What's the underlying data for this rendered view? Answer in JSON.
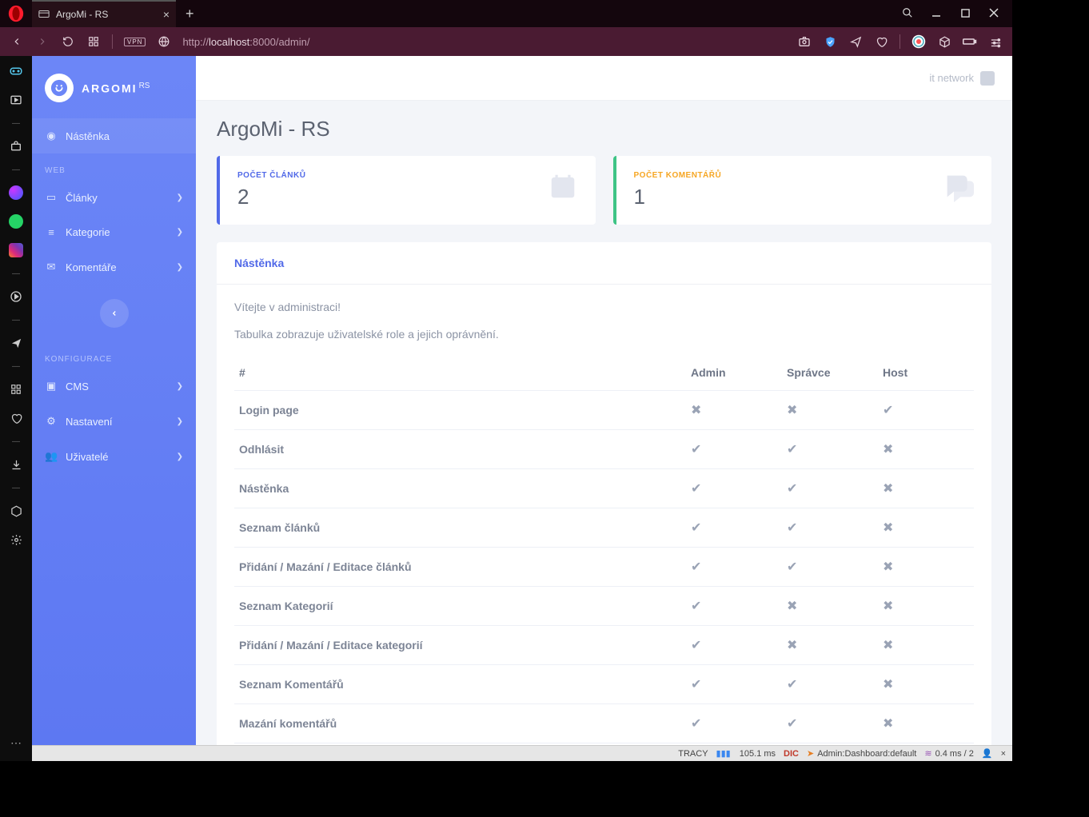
{
  "browser": {
    "tab_title": "ArgoMi - RS",
    "url_prefix": "http://",
    "url_host": "localhost",
    "url_port_path": ":8000/admin/",
    "vpn": "VPN"
  },
  "brand": {
    "name": "ARGOMI",
    "sup": "RS"
  },
  "nav": {
    "dashboard": "Nástěnka",
    "section_web": "WEB",
    "articles": "Články",
    "categories": "Kategorie",
    "comments": "Komentáře",
    "section_conf": "KONFIGURACE",
    "cms": "CMS",
    "settings": "Nastavení",
    "users": "Uživatelé"
  },
  "topbar": {
    "user": "it network"
  },
  "page": {
    "title": "ArgoMi - RS"
  },
  "stats": {
    "articles": {
      "label": "POČET ČLÁNKŮ",
      "value": "2"
    },
    "comments": {
      "label": "POČET KOMENTÁŘŮ",
      "value": "1"
    }
  },
  "panel": {
    "title": "Nástěnka",
    "welcome": "Vítejte v administraci!",
    "desc": "Tabulka zobrazuje uživatelské role a jejich oprávnění."
  },
  "table": {
    "head": {
      "hash": "#",
      "admin": "Admin",
      "manager": "Správce",
      "host": "Host"
    },
    "rows": [
      {
        "label": "Login page",
        "admin": false,
        "manager": false,
        "host": true
      },
      {
        "label": "Odhlásit",
        "admin": true,
        "manager": true,
        "host": false
      },
      {
        "label": "Nástěnka",
        "admin": true,
        "manager": true,
        "host": false
      },
      {
        "label": "Seznam článků",
        "admin": true,
        "manager": true,
        "host": false
      },
      {
        "label": "Přidání / Mazání / Editace článků",
        "admin": true,
        "manager": true,
        "host": false
      },
      {
        "label": "Seznam Kategorií",
        "admin": true,
        "manager": false,
        "host": false
      },
      {
        "label": "Přidání / Mazání / Editace kategorií",
        "admin": true,
        "manager": false,
        "host": false
      },
      {
        "label": "Seznam Komentářů",
        "admin": true,
        "manager": true,
        "host": false
      },
      {
        "label": "Mazání komentářů",
        "admin": true,
        "manager": true,
        "host": false
      }
    ]
  },
  "tracy": {
    "label": "TRACY",
    "time": "105.1 ms",
    "dic": "DIC",
    "route": "Admin:Dashboard:default",
    "db": "0.4 ms / 2",
    "close": "×"
  }
}
